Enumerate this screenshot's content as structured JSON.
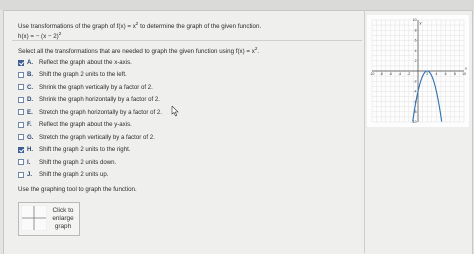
{
  "question": {
    "line1_before": "Use transformations of the graph of f(x) = x",
    "line1_exp": "2",
    "line1_after": " to determine the graph of the given function.",
    "function_before": "h(x) = − (x − 2)",
    "function_exp": "2"
  },
  "instructions": {
    "select_before": "Select all the transformations that are needed to graph the given function using f(x) = x",
    "select_exp": "2",
    "select_after": ".",
    "graph_tool": "Use the graphing tool to graph the function."
  },
  "options": [
    {
      "letter": "A.",
      "text": "Reflect the graph about the x-axis.",
      "checked": true
    },
    {
      "letter": "B.",
      "text": "Shift the graph 2 units to the left.",
      "checked": false
    },
    {
      "letter": "C.",
      "text": "Shrink the graph vertically by a factor of 2.",
      "checked": false
    },
    {
      "letter": "D.",
      "text": "Shrink the graph horizontally by a factor of 2.",
      "checked": false
    },
    {
      "letter": "E.",
      "text": "Stretch the graph horizontally by a factor of 2.",
      "checked": false
    },
    {
      "letter": "F.",
      "text": "Reflect the graph about the y-axis.",
      "checked": false
    },
    {
      "letter": "G.",
      "text": "Stretch the graph vertically by a factor of 2.",
      "checked": false
    },
    {
      "letter": "H.",
      "text": "Shift the graph 2 units to the right.",
      "checked": true
    },
    {
      "letter": "I.",
      "text": "Shift the graph 2 units down.",
      "checked": false
    },
    {
      "letter": "J.",
      "text": "Shift the graph 2 units up.",
      "checked": false
    }
  ],
  "enlarge": {
    "line1": "Click to",
    "line2": "enlarge",
    "line3": "graph"
  },
  "graph": {
    "x_range": [
      -10,
      10
    ],
    "y_range": [
      -10,
      10
    ],
    "x_tick_labels": [
      "-10",
      "-8",
      "-6",
      "-4",
      "-2",
      "2",
      "4",
      "6",
      "8",
      "10"
    ],
    "y_tick_labels": [
      "10",
      "8",
      "6",
      "4",
      "2",
      "-2",
      "-4",
      "-6",
      "-8",
      "-10"
    ],
    "x_axis_label": "x",
    "y_axis_label": "y",
    "curve": "h(x) = -(x-2)^2",
    "curve_color": "#2f6fb0"
  }
}
